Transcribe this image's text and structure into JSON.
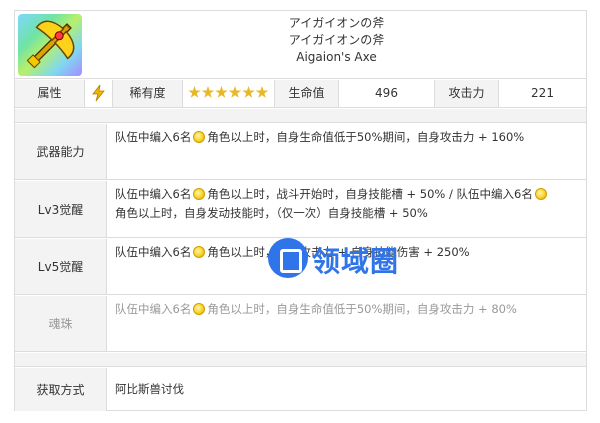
{
  "header": {
    "title_jp_1": "アイガイオンの斧",
    "title_jp_2": "アイガイオンの斧",
    "title_en": "Aigaion's Axe",
    "weapon_icon": "golden-axe-icon"
  },
  "stats": {
    "attribute_label": "属性",
    "attribute_icon": "lightning-icon",
    "rarity_label": "稀有度",
    "rarity_stars": 6,
    "hp_label": "生命值",
    "hp_value": "496",
    "atk_label": "攻击力",
    "atk_value": "221"
  },
  "abilities": [
    {
      "name": "武器能力",
      "line1_a": "队伍中编入6名",
      "line1_b": "角色以上时，自身生命值低于50%期间，自身攻击力 + 160%"
    },
    {
      "name": "Lv3觉醒",
      "line1_a": "队伍中编入6名",
      "line1_b": "角色以上时，战斗开始时，自身技能槽 + 50% / 队伍中编入6名",
      "line2": "角色以上时，自身发动技能时，（仅一次）自身技能槽 + 50%"
    },
    {
      "name": "Lv5觉醒",
      "line1_a": "队伍中编入6名",
      "line1_b": "角色以上时，自身攻击力 + 自身技能伤害 + 250%"
    },
    {
      "name": "魂珠",
      "line1_a": "队伍中编入6名",
      "line1_b": "角色以上时，自身生命值低于50%期间，自身攻击力 + 80%"
    }
  ],
  "acquire": {
    "label": "获取方式",
    "value": "阿比斯兽讨伐"
  },
  "watermark": {
    "text": "领域圈"
  },
  "colors": {
    "border": "#dcdcdc",
    "label_bg": "#f3f3f3",
    "gem": "#ffd83a",
    "star": "#e9b82a",
    "watermark": "#2f74e8"
  }
}
